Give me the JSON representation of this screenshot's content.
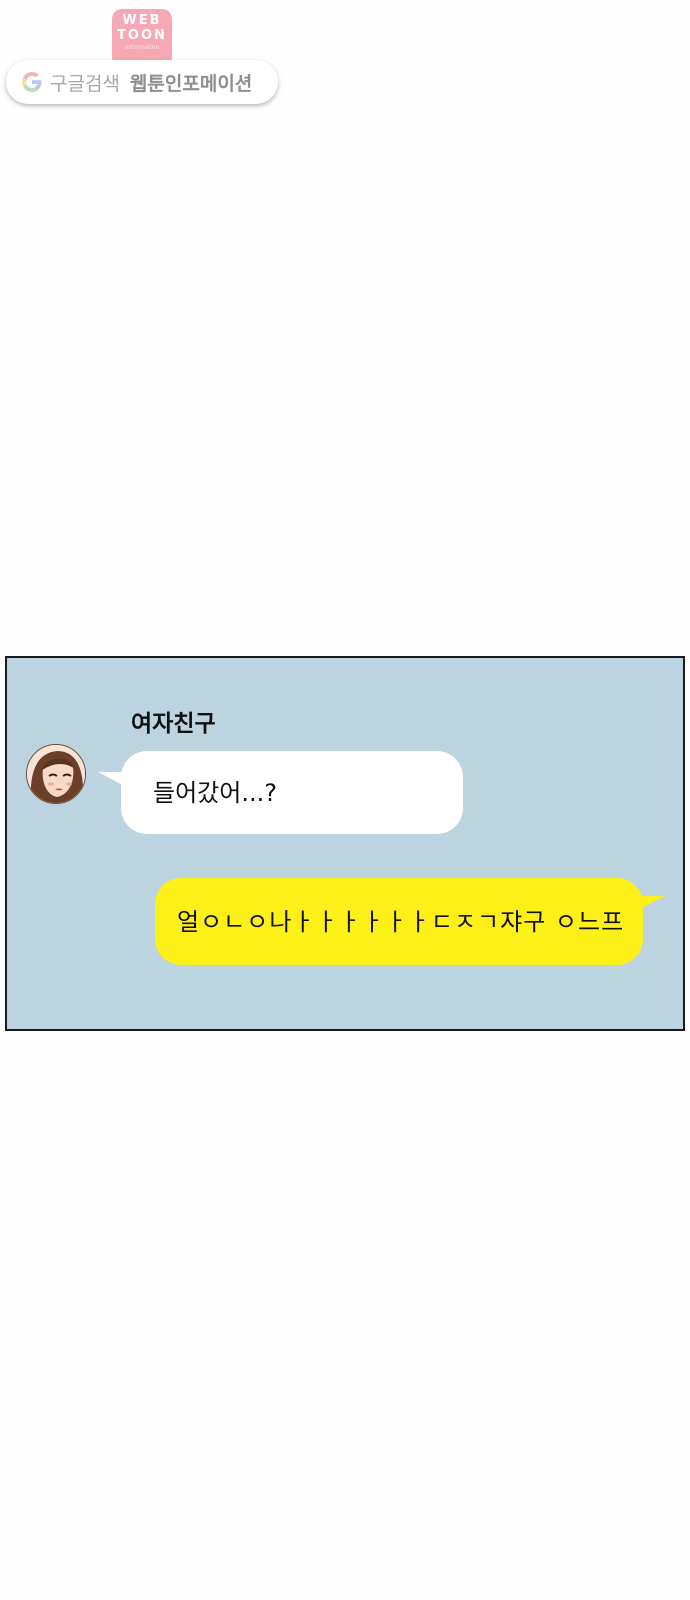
{
  "watermark": {
    "logo_line1": "WEB",
    "logo_line2": "TOON",
    "logo_line3": "information",
    "search_light": "구글검색",
    "search_bold": "웹툰인포메이션",
    "logo_color": "#f6a9b5"
  },
  "chat": {
    "background_color": "#bcd3e0",
    "sender_name": "여자친구",
    "incoming_message": "들어갔어...?",
    "outgoing_message": "얼ㅇㄴㅇ나ㅏㅏㅏㅏㅏㅏㄷㅈㄱ쟈구 ㅇ느프",
    "incoming_bubble_color": "#ffffff",
    "outgoing_bubble_color": "#fdef18",
    "avatar_icon": "girlfriend-avatar"
  }
}
